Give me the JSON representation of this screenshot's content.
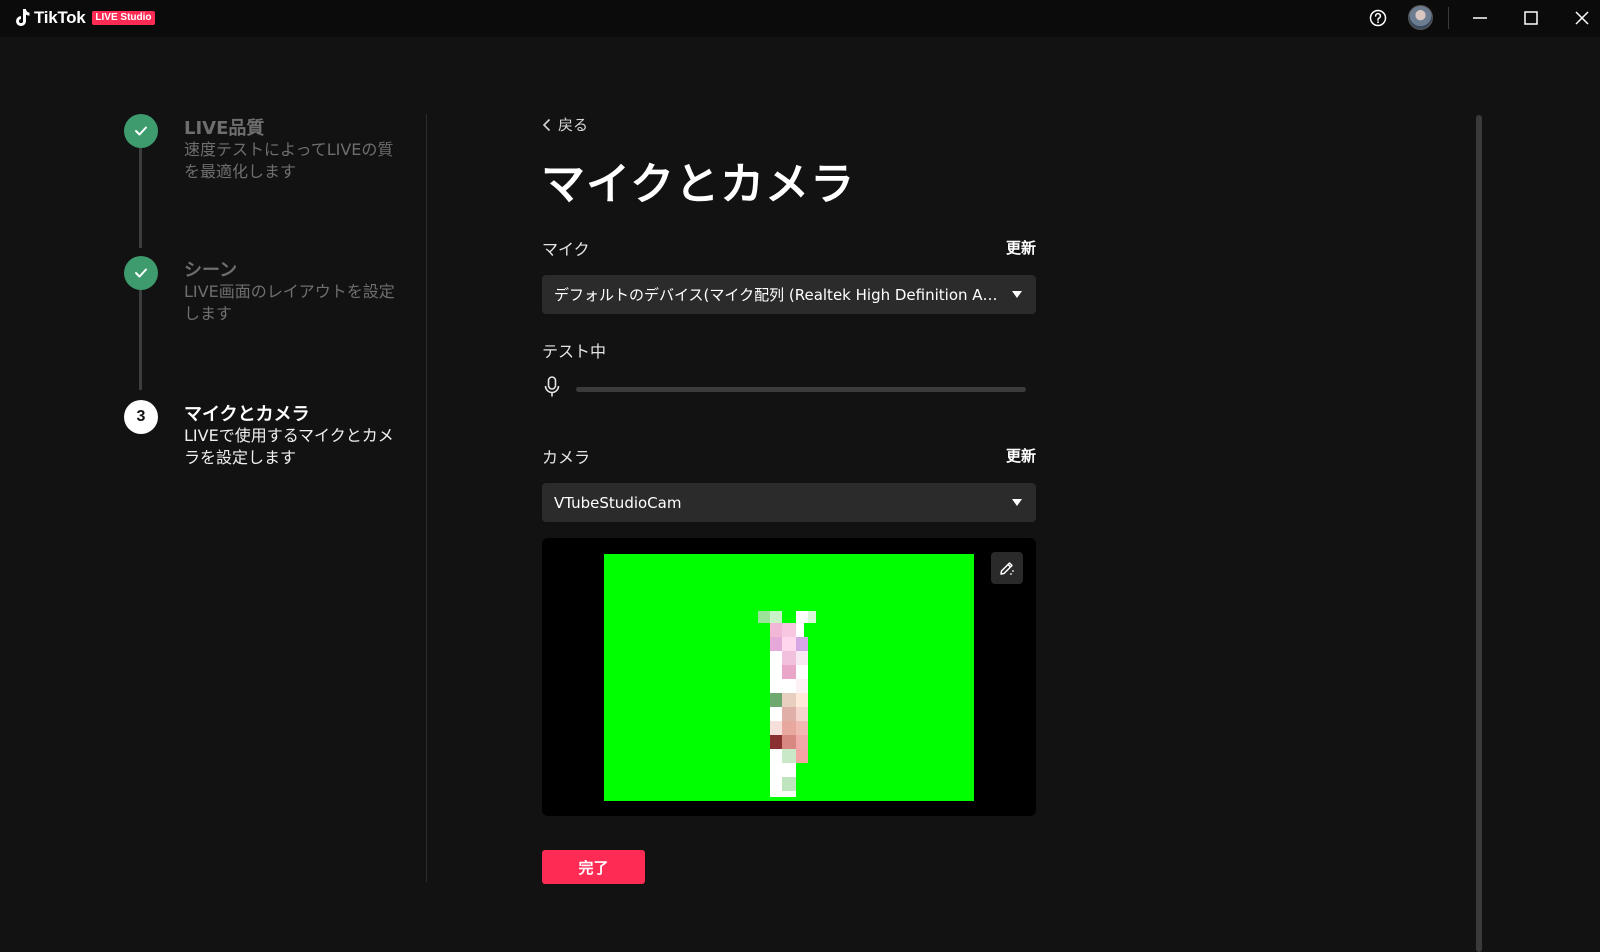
{
  "titlebar": {
    "app_name": "TikTok",
    "badge": "LIVE Studio",
    "icons": [
      "help-icon",
      "avatar",
      "minimize-icon",
      "maximize-icon",
      "close-icon"
    ]
  },
  "steps": [
    {
      "title": "LIVE品質",
      "desc": "速度テストによってLIVEの質を最適化します",
      "state": "done"
    },
    {
      "title": "シーン",
      "desc": "LIVE画面のレイアウトを設定します",
      "state": "done"
    },
    {
      "title": "マイクとカメラ",
      "desc": "LIVEで使用するマイクとカメラを設定します",
      "state": "active",
      "number": "3"
    }
  ],
  "main": {
    "back_label": "戻る",
    "title": "マイクとカメラ",
    "mic": {
      "label": "マイク",
      "refresh_label": "更新",
      "selected": "デフォルトのデバイス(マイク配列 (Realtek High Definition Aud...",
      "test_label": "テスト中",
      "level": 0
    },
    "camera": {
      "label": "カメラ",
      "refresh_label": "更新",
      "selected": "VTubeStudioCam"
    },
    "done_label": "完了"
  },
  "colors": {
    "accent": "#fe2c55",
    "step_done": "#3e9b6e",
    "preview_bg": "#00ff00"
  }
}
